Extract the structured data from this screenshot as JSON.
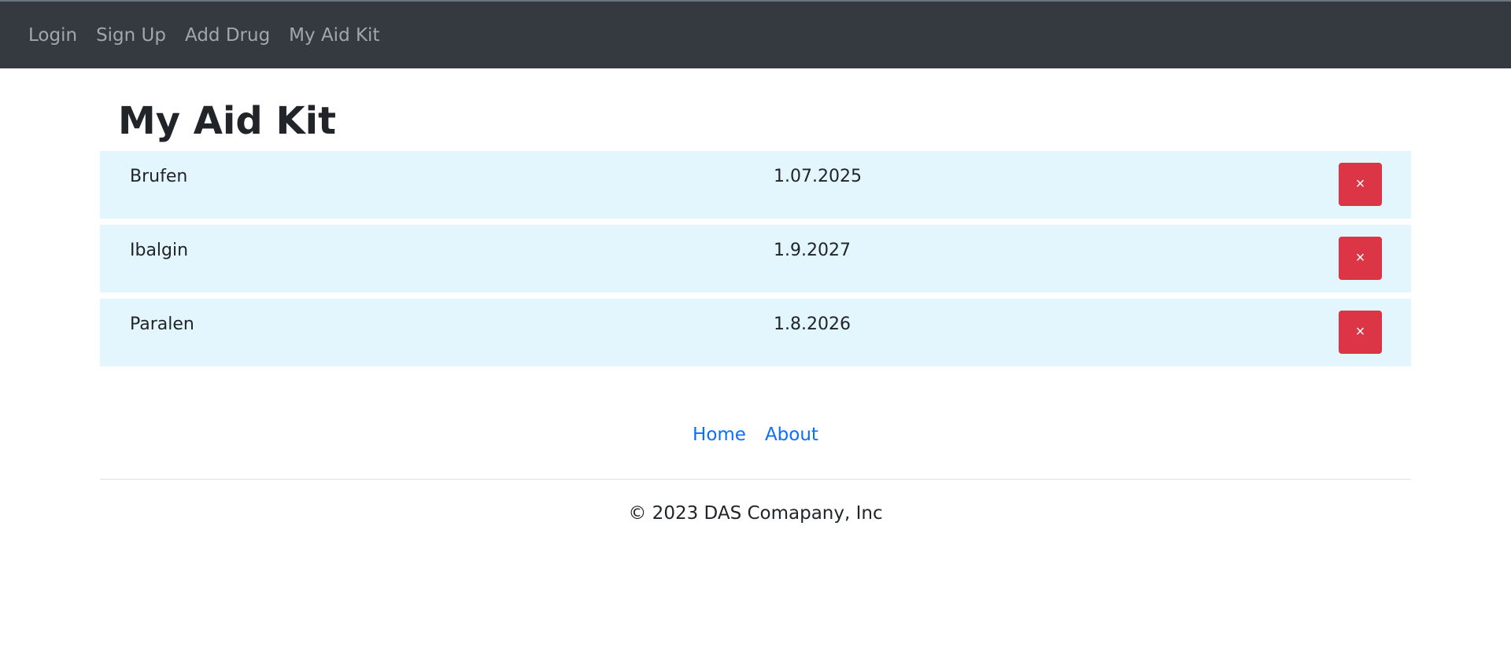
{
  "navbar": {
    "links": [
      {
        "label": "Login"
      },
      {
        "label": "Sign Up"
      },
      {
        "label": "Add Drug"
      },
      {
        "label": "My Aid Kit"
      }
    ]
  },
  "page": {
    "title": "My Aid Kit"
  },
  "kit": {
    "items": [
      {
        "name": "Brufen",
        "date": "1.07.2025",
        "delete_label": "×"
      },
      {
        "name": "Ibalgin",
        "date": "1.9.2027",
        "delete_label": "×"
      },
      {
        "name": "Paralen",
        "date": "1.8.2026",
        "delete_label": "×"
      }
    ]
  },
  "footer": {
    "links": [
      {
        "label": "Home"
      },
      {
        "label": "About"
      }
    ],
    "copyright": "© 2023 DAS Comapany, Inc"
  },
  "colors": {
    "navbar_bg": "#343a40",
    "row_bg": "#e3f5fd",
    "delete_button": "#dc3545",
    "link": "#0d6efd"
  }
}
